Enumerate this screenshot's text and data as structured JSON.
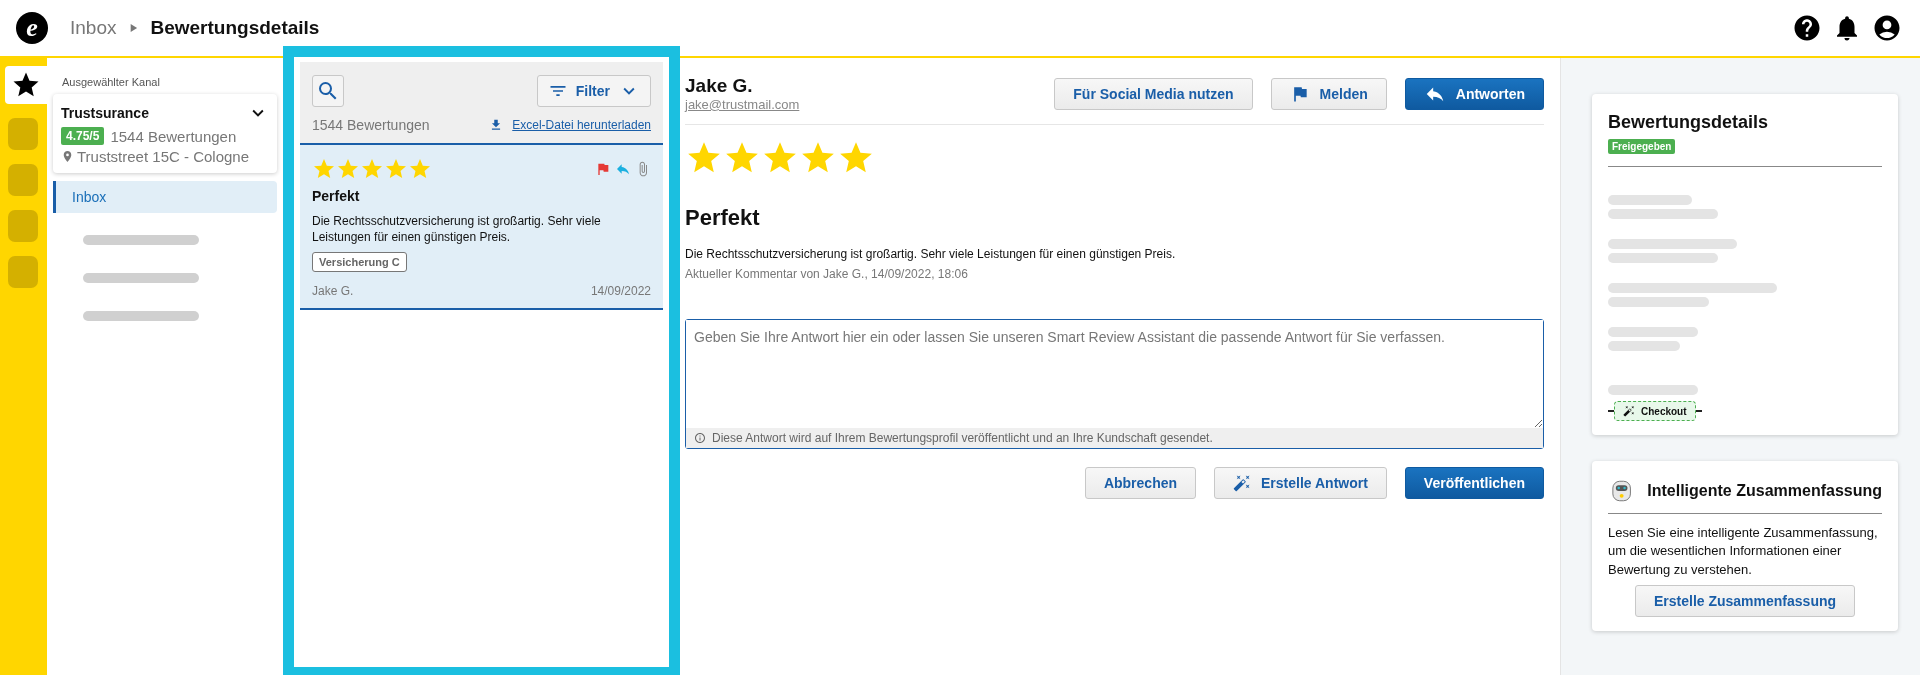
{
  "header": {
    "logo_letter": "e",
    "breadcrumb": [
      {
        "label": "Inbox",
        "current": false
      },
      {
        "label": "Bewertungsdetails",
        "current": true
      }
    ]
  },
  "rail": {
    "items": [
      {
        "kind": "star",
        "selected": true
      },
      {
        "kind": "blank",
        "selected": false
      },
      {
        "kind": "blank",
        "selected": false
      },
      {
        "kind": "blank",
        "selected": false
      },
      {
        "kind": "blank",
        "selected": false
      }
    ]
  },
  "channel": {
    "label": "Ausgewählter Kanal",
    "name": "Trustsurance",
    "rating": "4.75/5",
    "count": "1544 Bewertungen",
    "address": "Truststreet 15C - Cologne"
  },
  "nav": {
    "items": [
      {
        "label": "Inbox",
        "selected": true
      }
    ]
  },
  "list": {
    "filter_label": "Filter",
    "count": "1544 Bewertungen",
    "download_link": "Excel-Datei herunterladen",
    "reviews": [
      {
        "stars": 5,
        "title": "Perfekt",
        "text": "Die Rechtsschutzversicherung ist großartig. Sehr viele Leistungen für einen günstigen Preis.",
        "tag": "Versicherung C",
        "author": "Jake G.",
        "date": "14/09/2022",
        "selected": true,
        "flagged": true,
        "replied": true,
        "has_attachment": true
      }
    ]
  },
  "detail": {
    "name": "Jake G.",
    "email": "jake@trustmail.com",
    "actions": [
      {
        "label": "Für Social Media nutzen",
        "kind": "secondary"
      },
      {
        "label": "Melden",
        "kind": "secondary"
      },
      {
        "label": "Antworten",
        "kind": "primary"
      }
    ],
    "stars": 5,
    "title": "Perfekt",
    "text": "Die Rechtsschutzversicherung ist großartig. Sehr viele Leistungen für einen günstigen Preis.",
    "meta": "Aktueller Kommentar von Jake G., 14/09/2022, 18:06",
    "reply": {
      "placeholder": "Geben Sie Ihre Antwort hier ein oder lassen Sie unseren Smart Review Assistant die passende Antwort für Sie verfassen.",
      "hint": "Diese Antwort wird auf Ihrem Bewertungsprofil veröffentlicht und an Ihre Kundschaft gesendet."
    },
    "buttons": [
      {
        "label": "Abbrechen",
        "kind": "secondary"
      },
      {
        "label": "Erstelle Antwort",
        "kind": "secondary"
      },
      {
        "label": "Veröffentlichen",
        "kind": "primary"
      }
    ]
  },
  "details_card": {
    "title": "Bewertungsdetails",
    "status": "Freigegeben",
    "checkout": "Checkout"
  },
  "summary_card": {
    "title": "Intelligente Zusammenfassung",
    "text": "Lesen Sie eine intelligente Zusammenfassung, um die wesentlichen Informationen einer Bewertung zu verstehen.",
    "button": "Erstelle Zusammenfassung"
  }
}
